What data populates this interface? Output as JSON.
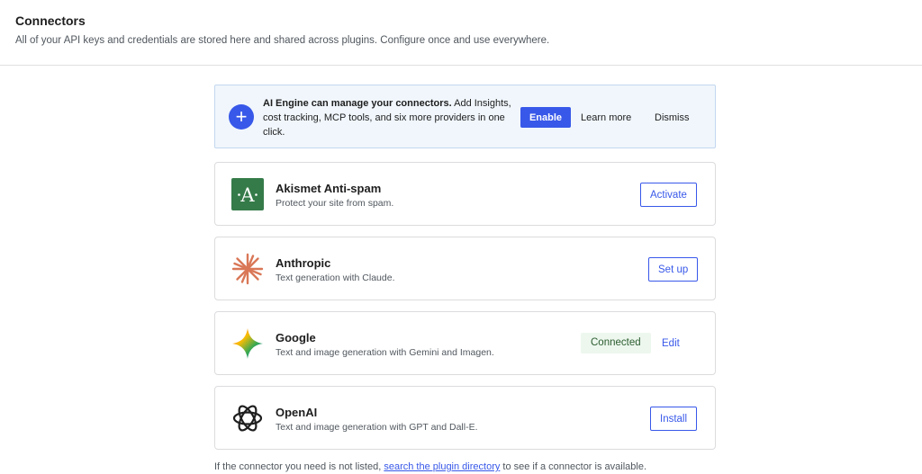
{
  "header": {
    "title": "Connectors",
    "subtitle": "All of your API keys and credentials are stored here and shared across plugins. Configure once and use everywhere."
  },
  "banner": {
    "icon": "plus-icon",
    "message_bold": "AI Engine can manage your connectors.",
    "message_rest": " Add Insights, cost tracking, MCP tools, and six more providers in one click.",
    "enable_label": "Enable",
    "learn_more_label": "Learn more",
    "dismiss_label": "Dismiss"
  },
  "connectors": [
    {
      "name": "Akismet Anti-spam",
      "description": "Protect your site from spam.",
      "action": "Activate",
      "icon": "akismet-logo-icon"
    },
    {
      "name": "Anthropic",
      "description": "Text generation with Claude.",
      "action": "Set up",
      "icon": "anthropic-logo-icon"
    },
    {
      "name": "Google",
      "description": "Text and image generation with Gemini and Imagen.",
      "status": "Connected",
      "action": "Edit",
      "icon": "gemini-logo-icon"
    },
    {
      "name": "OpenAI",
      "description": "Text and image generation with GPT and Dall-E.",
      "action": "Install",
      "icon": "openai-logo-icon"
    }
  ],
  "footer": {
    "before": "If the connector you need is not listed, ",
    "link": "search the plugin directory",
    "after": " to see if a connector is available."
  },
  "colors": {
    "accent": "#3858e9",
    "akismet": "#357b49",
    "anthropic": "#d97757",
    "connected_bg": "#edf7ee",
    "banner_bg": "#f0f6fc"
  }
}
